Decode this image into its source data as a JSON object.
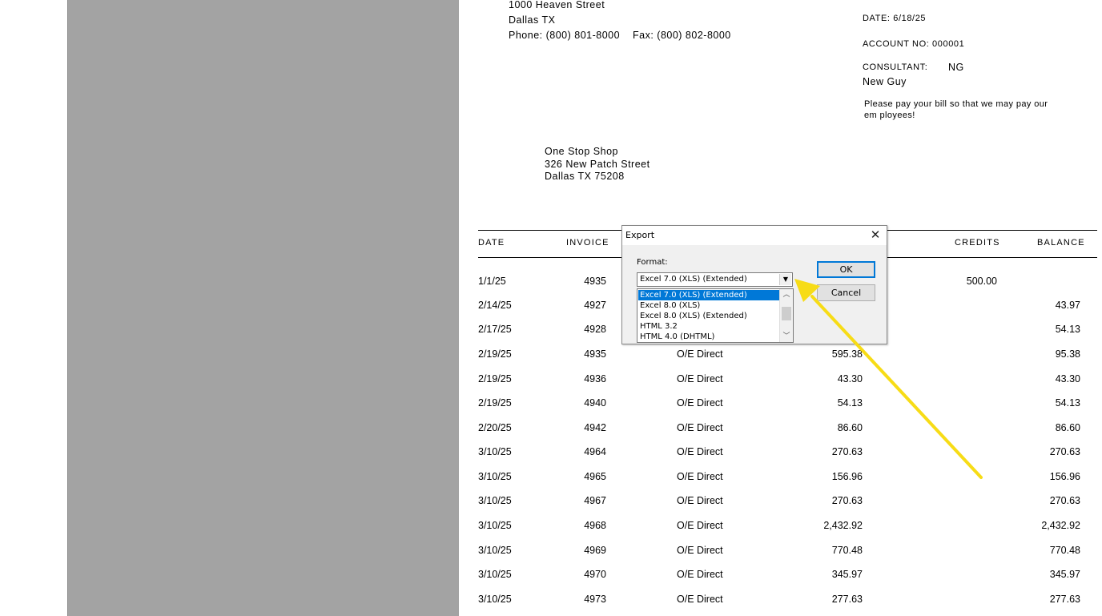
{
  "sender": {
    "street": "1000 Heaven Street",
    "city": "Dallas  TX",
    "phone": "Phone: (800) 801-8000",
    "fax": "Fax: (800) 802-8000"
  },
  "meta": {
    "date": "DATE:  6/18/25",
    "account": "ACCOUNT NO:  000001",
    "consultant_label": "CONSULTANT:",
    "consultant_code": "NG",
    "consultant_name": "New Guy",
    "note_line1": "Please pay your bill so that we may pay our",
    "note_line2": "em ployees!"
  },
  "recipient": {
    "name": "One Stop Shop",
    "street": "326 New Patch Street",
    "city": "Dallas TX 75208"
  },
  "columns": {
    "date": "DATE",
    "invoice": "INVOICE",
    "credits": "CREDITS",
    "balance": "BALANCE"
  },
  "rows": [
    {
      "date": "1/1/25",
      "invoice": "4935",
      "desc": "",
      "charges": "",
      "credits": "500.00",
      "balance": ""
    },
    {
      "date": "2/14/25",
      "invoice": "4927",
      "desc": "",
      "charges": "",
      "credits": "",
      "balance": "43.97"
    },
    {
      "date": "2/17/25",
      "invoice": "4928",
      "desc": "",
      "charges": "",
      "credits": "",
      "balance": "54.13"
    },
    {
      "date": "2/19/25",
      "invoice": "4935",
      "desc": "O/E Direct",
      "charges": "595.38",
      "credits": "",
      "balance": "95.38"
    },
    {
      "date": "2/19/25",
      "invoice": "4936",
      "desc": "O/E Direct",
      "charges": "43.30",
      "credits": "",
      "balance": "43.30"
    },
    {
      "date": "2/19/25",
      "invoice": "4940",
      "desc": "O/E Direct",
      "charges": "54.13",
      "credits": "",
      "balance": "54.13"
    },
    {
      "date": "2/20/25",
      "invoice": "4942",
      "desc": "O/E Direct",
      "charges": "86.60",
      "credits": "",
      "balance": "86.60"
    },
    {
      "date": "3/10/25",
      "invoice": "4964",
      "desc": "O/E Direct",
      "charges": "270.63",
      "credits": "",
      "balance": "270.63"
    },
    {
      "date": "3/10/25",
      "invoice": "4965",
      "desc": "O/E Direct",
      "charges": "156.96",
      "credits": "",
      "balance": "156.96"
    },
    {
      "date": "3/10/25",
      "invoice": "4967",
      "desc": "O/E Direct",
      "charges": "270.63",
      "credits": "",
      "balance": "270.63"
    },
    {
      "date": "3/10/25",
      "invoice": "4968",
      "desc": "O/E Direct",
      "charges": "2,432.92",
      "credits": "",
      "balance": "2,432.92"
    },
    {
      "date": "3/10/25",
      "invoice": "4969",
      "desc": "O/E Direct",
      "charges": "770.48",
      "credits": "",
      "balance": "770.48"
    },
    {
      "date": "3/10/25",
      "invoice": "4970",
      "desc": "O/E Direct",
      "charges": "345.97",
      "credits": "",
      "balance": "345.97"
    },
    {
      "date": "3/10/25",
      "invoice": "4973",
      "desc": "O/E Direct",
      "charges": "277.63",
      "credits": "",
      "balance": "277.63"
    }
  ],
  "dialog": {
    "title": "Export",
    "format_label": "Format:",
    "selected": "Excel 7.0 (XLS) (Extended)",
    "options": [
      "Excel 7.0 (XLS) (Extended)",
      "Excel 8.0 (XLS)",
      "Excel 8.0 (XLS) (Extended)",
      "HTML 3.2",
      "HTML 4.0 (DHTML)"
    ],
    "ok_label": "OK",
    "cancel_label": "Cancel"
  },
  "colors": {
    "panel_gray": "#a3a3a3",
    "selection_blue": "#0078d7",
    "arrow_yellow": "#f7dc16"
  }
}
